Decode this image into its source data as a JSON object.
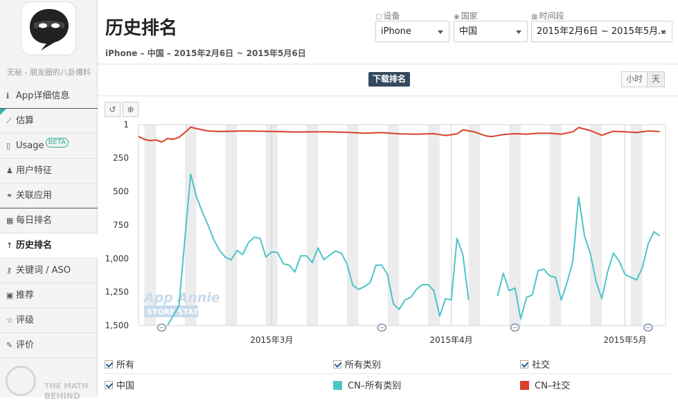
{
  "sidebar": {
    "app_name": "无秘 - 朋友圈的八卦爆料",
    "items": [
      {
        "label": "App详细信息",
        "icon": "info-icon",
        "glyph": "ℹ"
      },
      {
        "label": "估算",
        "icon": "line-chart-icon",
        "glyph": "⟋"
      },
      {
        "label": "Usage",
        "icon": "phone-icon",
        "glyph": "▯",
        "badge": "BETA"
      },
      {
        "label": "用户特征",
        "icon": "person-icon",
        "glyph": "♟"
      },
      {
        "label": "关联应用",
        "icon": "link-icon",
        "glyph": "⚭"
      },
      {
        "label": "每日排名",
        "icon": "calendar-icon",
        "glyph": "▦"
      },
      {
        "label": "历史排名",
        "icon": "arrow-up-icon",
        "glyph": "↑"
      },
      {
        "label": "关键词 / ASO",
        "icon": "key-icon",
        "glyph": "⚷"
      },
      {
        "label": "推荐",
        "icon": "feature-icon",
        "glyph": "▣"
      },
      {
        "label": "评级",
        "icon": "star-icon",
        "glyph": "☆"
      },
      {
        "label": "评价",
        "icon": "comment-icon",
        "glyph": "✎"
      }
    ],
    "footer": {
      "line1": "THE MATH",
      "line2": "BEHIND"
    }
  },
  "header": {
    "title": "历史排名",
    "subtitle": "iPhone – 中国 – 2015年2月6日 ~ 2015年5月6日"
  },
  "filters": {
    "device": {
      "label": "设备",
      "value": "iPhone"
    },
    "country": {
      "label": "国家",
      "value": "中国"
    },
    "period": {
      "label": "时间段",
      "value": "2015年2月6日 ~ 2015年5月..."
    }
  },
  "chart_tab": "下载排名",
  "granularity": {
    "hour": "小时",
    "day": "天",
    "selected": "天"
  },
  "watermark": {
    "line1": "App Annie",
    "line2": "STORE STATS"
  },
  "legend": {
    "row1": [
      {
        "label": "所有"
      },
      {
        "label": "所有类别"
      },
      {
        "label": "社交"
      }
    ],
    "row2": [
      {
        "label": "中国",
        "type": "checkbox"
      },
      {
        "label": "CN–所有类别",
        "color": "#4cc4c8"
      },
      {
        "label": "CN–社交",
        "color": "#d9402a"
      }
    ]
  },
  "chart_data": {
    "type": "line",
    "x_start": "2015-02-06",
    "x_end": "2015-05-06",
    "x_ticks": [
      {
        "label": "2015年3月",
        "date": "2015-03-01"
      },
      {
        "label": "2015年4月",
        "date": "2015-04-01"
      },
      {
        "label": "2015年5月",
        "date": "2015-05-01"
      }
    ],
    "y_reversed": true,
    "ylim": [
      1,
      1500
    ],
    "y_ticks": [
      "1",
      "250",
      "500",
      "750",
      "1,000",
      "1,250",
      "1,500"
    ],
    "y_tick_values": [
      1,
      250,
      500,
      750,
      1000,
      1250,
      1500
    ],
    "event_markers": [
      "2015-02-10",
      "2015-03-20",
      "2015-04-12",
      "2015-05-05"
    ],
    "series": [
      {
        "name": "CN–所有类别",
        "color": "#4cc4c8",
        "points": [
          [
            "2015-02-11",
            1500
          ],
          [
            "2015-02-13",
            1350
          ],
          [
            "2015-02-15",
            370
          ],
          [
            "2015-02-16",
            540
          ],
          [
            "2015-02-17",
            650
          ],
          [
            "2015-02-18",
            750
          ],
          [
            "2015-02-19",
            860
          ],
          [
            "2015-02-20",
            940
          ],
          [
            "2015-02-21",
            990
          ],
          [
            "2015-02-22",
            1010
          ],
          [
            "2015-02-23",
            940
          ],
          [
            "2015-02-24",
            970
          ],
          [
            "2015-02-25",
            880
          ],
          [
            "2015-02-26",
            840
          ],
          [
            "2015-02-27",
            850
          ],
          [
            "2015-02-28",
            990
          ],
          [
            "2015-03-01",
            950
          ],
          [
            "2015-03-02",
            955
          ],
          [
            "2015-03-03",
            1040
          ],
          [
            "2015-03-04",
            1050
          ],
          [
            "2015-03-05",
            1100
          ],
          [
            "2015-03-06",
            980
          ],
          [
            "2015-03-07",
            980
          ],
          [
            "2015-03-08",
            1030
          ],
          [
            "2015-03-09",
            920
          ],
          [
            "2015-03-10",
            1010
          ],
          [
            "2015-03-11",
            975
          ],
          [
            "2015-03-12",
            945
          ],
          [
            "2015-03-13",
            960
          ],
          [
            "2015-03-14",
            1040
          ],
          [
            "2015-03-15",
            1200
          ],
          [
            "2015-03-16",
            1230
          ],
          [
            "2015-03-17",
            1210
          ],
          [
            "2015-03-18",
            1180
          ],
          [
            "2015-03-19",
            1050
          ],
          [
            "2015-03-20",
            1050
          ],
          [
            "2015-03-21",
            1120
          ],
          [
            "2015-03-22",
            1340
          ],
          [
            "2015-03-23",
            1380
          ],
          [
            "2015-03-24",
            1310
          ],
          [
            "2015-03-25",
            1290
          ],
          [
            "2015-03-26",
            1230
          ],
          [
            "2015-03-27",
            1195
          ],
          [
            "2015-03-28",
            1195
          ],
          [
            "2015-03-29",
            1240
          ],
          [
            "2015-03-30",
            1430
          ],
          [
            "2015-03-31",
            1300
          ],
          [
            "2015-04-01",
            1310
          ],
          [
            "2015-04-02",
            850
          ],
          [
            "2015-04-03",
            970
          ],
          [
            "2015-04-04",
            1310
          ],
          null,
          [
            "2015-04-09",
            1280
          ],
          [
            "2015-04-10",
            1110
          ],
          [
            "2015-04-11",
            1240
          ],
          [
            "2015-04-12",
            1220
          ],
          [
            "2015-04-13",
            1450
          ],
          [
            "2015-04-14",
            1290
          ],
          [
            "2015-04-15",
            1270
          ],
          [
            "2015-04-16",
            1090
          ],
          [
            "2015-04-17",
            1080
          ],
          [
            "2015-04-18",
            1130
          ],
          [
            "2015-04-19",
            1140
          ],
          [
            "2015-04-20",
            1310
          ],
          [
            "2015-04-21",
            1180
          ],
          [
            "2015-04-22",
            1020
          ],
          [
            "2015-04-23",
            540
          ],
          [
            "2015-04-24",
            830
          ],
          [
            "2015-04-25",
            960
          ],
          [
            "2015-04-26",
            1170
          ],
          [
            "2015-04-27",
            1300
          ],
          [
            "2015-04-28",
            1100
          ],
          [
            "2015-04-29",
            960
          ],
          [
            "2015-04-30",
            1020
          ],
          [
            "2015-05-01",
            1120
          ],
          [
            "2015-05-02",
            1140
          ],
          [
            "2015-05-03",
            1160
          ],
          [
            "2015-05-04",
            1070
          ],
          [
            "2015-05-05",
            890
          ],
          [
            "2015-05-06",
            800
          ],
          [
            "2015-05-07",
            830
          ]
        ]
      },
      {
        "name": "CN–社交",
        "color": "#d9402a",
        "points": [
          [
            "2015-02-06",
            90
          ],
          [
            "2015-02-07",
            110
          ],
          [
            "2015-02-08",
            120
          ],
          [
            "2015-02-09",
            115
          ],
          [
            "2015-02-10",
            130
          ],
          [
            "2015-02-11",
            105
          ],
          [
            "2015-02-12",
            110
          ],
          [
            "2015-02-13",
            95
          ],
          [
            "2015-02-14",
            60
          ],
          [
            "2015-02-15",
            20
          ],
          [
            "2015-02-16",
            30
          ],
          [
            "2015-02-17",
            40
          ],
          [
            "2015-02-18",
            48
          ],
          [
            "2015-02-20",
            52
          ],
          [
            "2015-02-22",
            50
          ],
          [
            "2015-02-24",
            48
          ],
          [
            "2015-02-27",
            50
          ],
          [
            "2015-03-02",
            52
          ],
          [
            "2015-03-05",
            56
          ],
          [
            "2015-03-08",
            55
          ],
          [
            "2015-03-11",
            55
          ],
          [
            "2015-03-14",
            58
          ],
          [
            "2015-03-17",
            65
          ],
          [
            "2015-03-20",
            60
          ],
          [
            "2015-03-23",
            70
          ],
          [
            "2015-03-26",
            72
          ],
          [
            "2015-03-29",
            68
          ],
          [
            "2015-03-31",
            82
          ],
          [
            "2015-04-02",
            70
          ],
          [
            "2015-04-03",
            40
          ],
          [
            "2015-04-05",
            55
          ],
          [
            "2015-04-07",
            85
          ],
          [
            "2015-04-08",
            90
          ],
          [
            "2015-04-10",
            75
          ],
          [
            "2015-04-12",
            68
          ],
          [
            "2015-04-14",
            72
          ],
          [
            "2015-04-16",
            65
          ],
          [
            "2015-04-18",
            65
          ],
          [
            "2015-04-20",
            72
          ],
          [
            "2015-04-22",
            55
          ],
          [
            "2015-04-23",
            22
          ],
          [
            "2015-04-25",
            45
          ],
          [
            "2015-04-27",
            80
          ],
          [
            "2015-04-29",
            50
          ],
          [
            "2015-05-01",
            55
          ],
          [
            "2015-05-03",
            60
          ],
          [
            "2015-05-05",
            48
          ],
          [
            "2015-05-07",
            52
          ]
        ]
      }
    ]
  }
}
